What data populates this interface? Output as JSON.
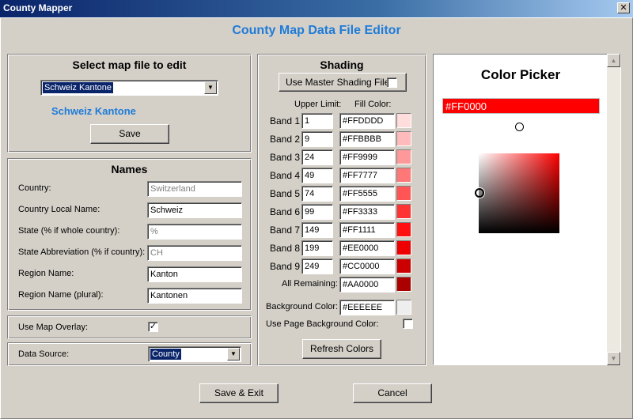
{
  "window": {
    "title": "County Mapper",
    "close_glyph": "✕"
  },
  "heading": "County Map Data File Editor",
  "map_select": {
    "title": "Select map file to edit",
    "selected": "Schweiz Kantone",
    "display_name": "Schweiz Kantone",
    "save_label": "Save"
  },
  "names": {
    "title": "Names",
    "fields": [
      {
        "label": "Country:",
        "value": "Switzerland",
        "disabled": true
      },
      {
        "label": "Country Local Name:",
        "value": "Schweiz",
        "disabled": false
      },
      {
        "label": "State (% if whole country):",
        "value": "%",
        "disabled": true
      },
      {
        "label": "State Abbreviation (% if country):",
        "value": "CH",
        "disabled": true
      },
      {
        "label": "Region Name:",
        "value": "Kanton",
        "disabled": false
      },
      {
        "label": "Region Name (plural):",
        "value": "Kantonen",
        "disabled": false
      }
    ]
  },
  "map_overlay": {
    "label": "Use Map Overlay:",
    "checked": true,
    "check_glyph": "✓"
  },
  "data_source": {
    "label": "Data Source:",
    "selected": "County"
  },
  "shading": {
    "title": "Shading",
    "use_master_label": "Use Master Shading File:",
    "use_master_checked": false,
    "upper_limit_header": "Upper Limit:",
    "fill_color_header": "Fill Color:",
    "bands": [
      {
        "label": "Band 1",
        "limit": "1",
        "color": "#FFDDDD"
      },
      {
        "label": "Band 2",
        "limit": "9",
        "color": "#FFBBBB"
      },
      {
        "label": "Band 3",
        "limit": "24",
        "color": "#FF9999"
      },
      {
        "label": "Band 4",
        "limit": "49",
        "color": "#FF7777"
      },
      {
        "label": "Band 5",
        "limit": "74",
        "color": "#FF5555"
      },
      {
        "label": "Band 6",
        "limit": "99",
        "color": "#FF3333"
      },
      {
        "label": "Band 7",
        "limit": "149",
        "color": "#FF1111"
      },
      {
        "label": "Band 8",
        "limit": "199",
        "color": "#EE0000"
      },
      {
        "label": "Band 9",
        "limit": "249",
        "color": "#CC0000"
      }
    ],
    "all_remaining_label": "All Remaining:",
    "all_remaining_color": "#AA0000",
    "background_label": "Background Color:",
    "background_color": "#EEEEEE",
    "use_page_bg_label": "Use Page Background Color:",
    "use_page_bg_checked": false,
    "refresh_label": "Refresh Colors"
  },
  "color_picker": {
    "title": "Color Picker",
    "value": "#FF0000",
    "hue_color": "#FF0000"
  },
  "footer": {
    "save_exit_label": "Save & Exit",
    "cancel_label": "Cancel"
  },
  "icons": {
    "dropdown": "chevron-down-icon",
    "scroll_up": "arrow-up-icon",
    "scroll_down": "arrow-down-icon"
  }
}
